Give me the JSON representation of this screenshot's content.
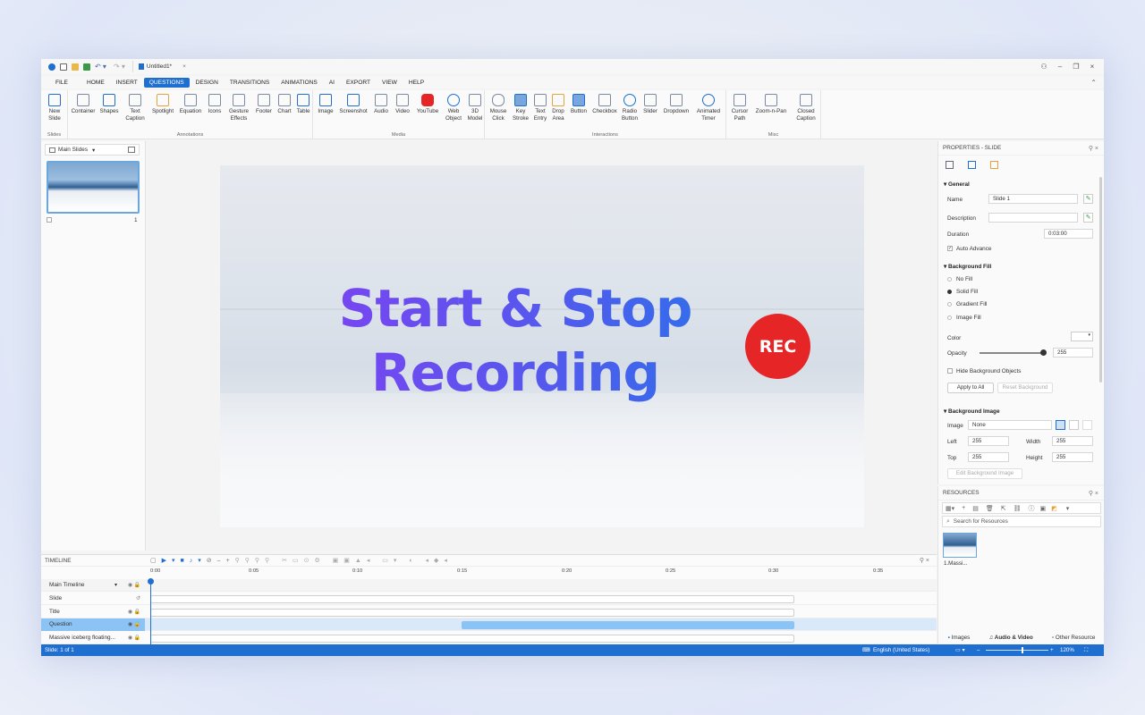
{
  "window": {
    "doc_tab": "Untitled1*"
  },
  "menu": [
    "FILE",
    "HOME",
    "INSERT",
    "QUESTIONS",
    "DESIGN",
    "TRANSITIONS",
    "ANIMATIONS",
    "AI",
    "EXPORT",
    "VIEW",
    "HELP"
  ],
  "menu_active": "QUESTIONS",
  "ribbon": {
    "slides": {
      "label": "Slides",
      "new_slide": "New Slide"
    },
    "annotations": {
      "label": "Annotations",
      "items": [
        "Container",
        "Shapes",
        "Text Caption",
        "Spotlight",
        "Equation",
        "Icons",
        "Gesture Effects",
        "Footer",
        "Chart",
        "Table"
      ]
    },
    "media": {
      "label": "Media",
      "items": [
        "Image",
        "Screenshot",
        "Audio",
        "Video",
        "YouTube",
        "Web Object",
        "3D Model"
      ]
    },
    "interactions": {
      "label": "Interactions",
      "items": [
        "Mouse Click",
        "Key Stroke",
        "Text Entry",
        "Drop Area",
        "Button",
        "Checkbox",
        "Radio Button",
        "Slider",
        "Dropdown",
        "Animated Timer"
      ]
    },
    "misc": {
      "label": "Misc",
      "items": [
        "Cursor Path",
        "Zoom-n-Pan",
        "Closed Caption"
      ]
    }
  },
  "slides_panel": {
    "dropdown": "Main Slides",
    "slide_number": "1"
  },
  "slide": {
    "title_line1": "Start & Stop",
    "title_line2": "Recording",
    "rec_badge": "REC"
  },
  "properties": {
    "header": "PROPERTIES - SLIDE",
    "general": "General",
    "name_label": "Name",
    "name_value": "Slide 1",
    "description_label": "Description",
    "description_value": "",
    "duration_label": "Duration",
    "duration_value": "0:03:00",
    "auto_advance": "Auto Advance",
    "background_fill": "Background Fill",
    "fill_options": [
      "No Fill",
      "Solid Fill",
      "Gradient Fill",
      "Image Fill"
    ],
    "fill_selected": "Solid Fill",
    "color_label": "Color",
    "opacity_label": "Opacity",
    "opacity_value": "255",
    "hide_background": "Hide Background Objects",
    "apply_to_all": "Apply to All",
    "reset_background": "Reset Background",
    "background_image": "Background Image",
    "image_label": "Image",
    "image_value": "None",
    "left_label": "Left",
    "left_value": "255",
    "width_label": "Width",
    "width_value": "255",
    "top_label": "Top",
    "top_value": "255",
    "height_label": "Height",
    "height_value": "255",
    "edit_background_image": "Edit Background Image"
  },
  "resources": {
    "header": "RESOURCES",
    "search_placeholder": "Search for Resources",
    "item_label": "1.Massi...",
    "tabs": [
      "Images",
      "Audio & Video",
      "Other Resource"
    ]
  },
  "timeline": {
    "header": "TIMELINE",
    "ticks": [
      "0:00",
      "0:05",
      "0:10",
      "0:15",
      "0:20",
      "0:25",
      "0:30",
      "0:35"
    ],
    "rows": [
      "Main Timeline",
      "Slide",
      "Title",
      "Question",
      "Massive iceberg floating..."
    ],
    "selected_row": "Question"
  },
  "status": {
    "slide": "Slide: 1 of 1",
    "language": "English (United States)",
    "zoom": "120%"
  },
  "colors": {
    "accent": "#1e6fd0",
    "rec": "#e52526",
    "question_bar": "#8cc3f5"
  }
}
